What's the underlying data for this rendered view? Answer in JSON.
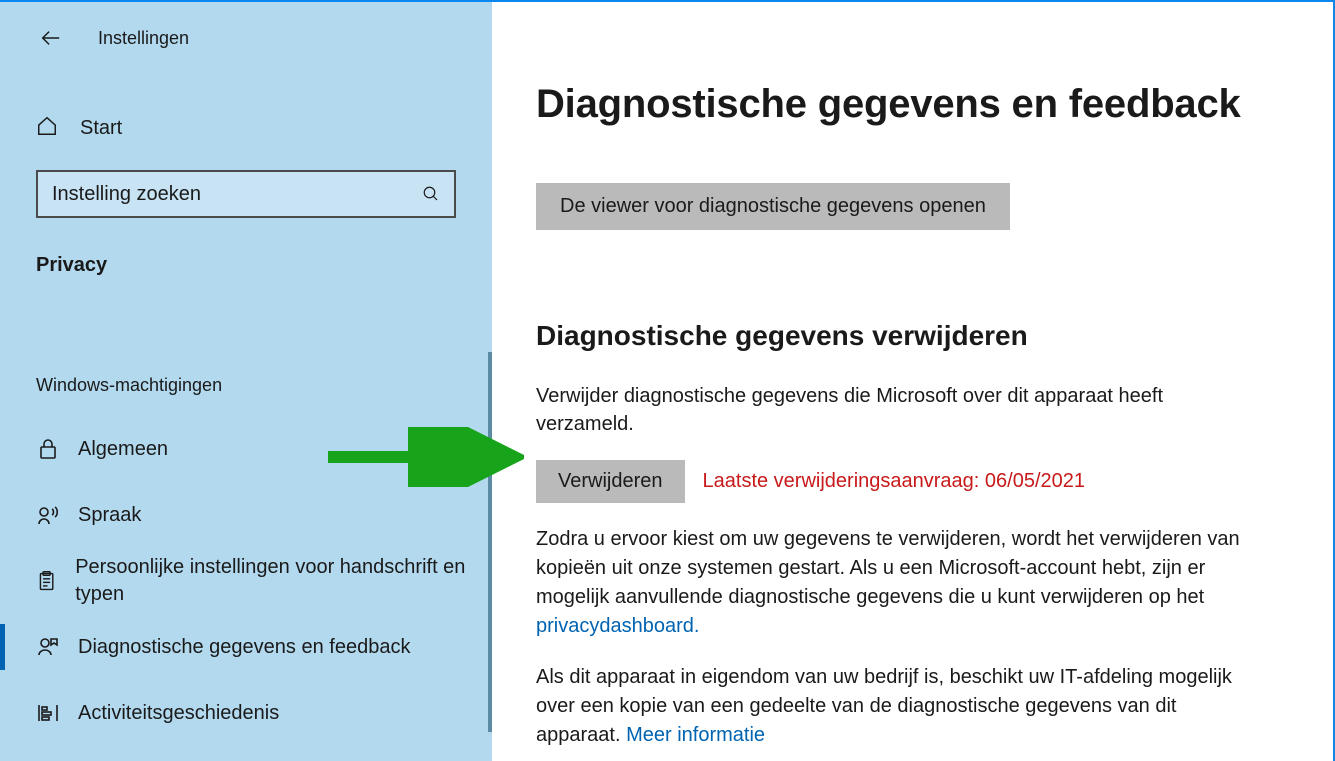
{
  "header": {
    "title": "Instellingen"
  },
  "home": {
    "label": "Start"
  },
  "search": {
    "placeholder": "Instelling zoeken"
  },
  "section_label": "Privacy",
  "subsection_label": "Windows-machtigingen",
  "nav": {
    "items": [
      {
        "label": "Algemeen"
      },
      {
        "label": "Spraak"
      },
      {
        "label": "Persoonlijke instellingen voor handschrift en typen"
      },
      {
        "label": "Diagnostische gegevens en feedback"
      },
      {
        "label": "Activiteitsgeschiedenis"
      }
    ]
  },
  "main": {
    "title": "Diagnostische gegevens en feedback",
    "open_viewer_button": "De viewer voor diagnostische gegevens openen",
    "delete_section_title": "Diagnostische gegevens verwijderen",
    "delete_desc": "Verwijder diagnostische gegevens die Microsoft over dit apparaat heeft verzameld.",
    "delete_button": "Verwijderen",
    "delete_status": "Laatste verwijderingsaanvraag: 06/05/2021",
    "para1_a": "Zodra u ervoor kiest om uw gegevens te verwijderen, wordt het verwijderen van kopieën uit onze systemen gestart. Als u een Microsoft-account hebt, zijn er mogelijk aanvullende diagnostische gegevens die u kunt verwijderen op het ",
    "para1_link": "privacydashboard.",
    "para2_a": "Als dit apparaat in eigendom van uw bedrijf is, beschikt uw IT-afdeling mogelijk over een kopie van een gedeelte van de diagnostische gegevens van dit apparaat. ",
    "para2_link": "Meer informatie"
  }
}
